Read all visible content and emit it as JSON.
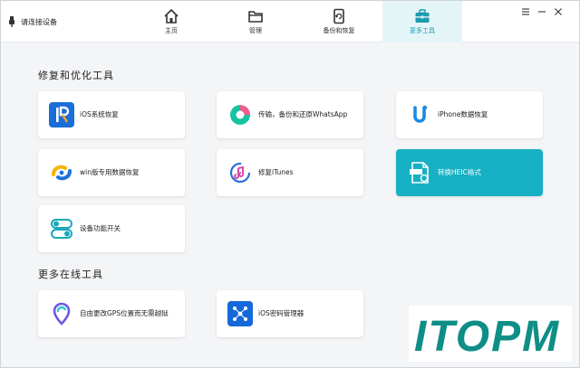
{
  "header": {
    "status_text": "请连接设备",
    "tabs": [
      {
        "label": "主页",
        "icon": "home-icon"
      },
      {
        "label": "管理",
        "icon": "folder-icon"
      },
      {
        "label": "备份和恢复",
        "icon": "backup-restore-icon"
      },
      {
        "label": "更多工具",
        "icon": "toolbox-icon",
        "active": true
      }
    ],
    "window_controls": [
      "menu-icon",
      "minimize-icon",
      "close-icon"
    ]
  },
  "sections": [
    {
      "title": "修复和优化工具",
      "tools": [
        {
          "label": "iOS系统恢复",
          "icon": "ios-repair-icon"
        },
        {
          "label": "传输，备份和还原WhatsApp",
          "icon": "whatsapp-transfer-icon"
        },
        {
          "label": "iPhone数据恢复",
          "icon": "iphone-data-recovery-icon"
        },
        {
          "label": "win版专用数据恢复",
          "icon": "windows-data-recovery-icon"
        },
        {
          "label": "修复iTunes",
          "icon": "itunes-repair-icon"
        },
        {
          "label": "转换HEIC格式",
          "icon": "heic-convert-icon",
          "selected": true
        },
        {
          "label": "设备功能开关",
          "icon": "device-toggle-icon"
        }
      ]
    },
    {
      "title": "更多在线工具",
      "tools": [
        {
          "label": "自由更改GPS位置而无需越狱",
          "icon": "gps-location-icon"
        },
        {
          "label": "iOS密码管理器",
          "icon": "password-manager-icon"
        }
      ]
    }
  ],
  "watermark": {
    "text": "ITOPM"
  },
  "colors": {
    "accent": "#17b0c4",
    "active_tab_bg": "#e4f5f8",
    "background": "#f4f5f7"
  }
}
